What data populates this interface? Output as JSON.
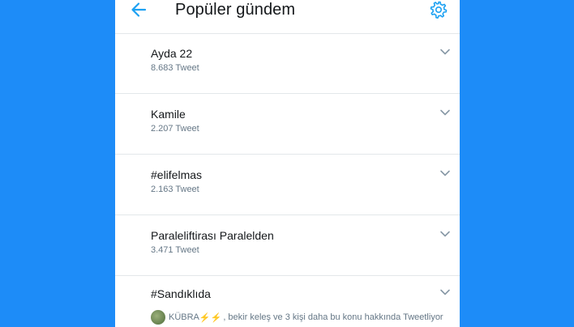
{
  "header": {
    "title": "Popüler gündem",
    "back_icon": "arrow-left-icon",
    "settings_icon": "gear-icon",
    "accent": "#1da1f2"
  },
  "trends": [
    {
      "title": "Ayda 22",
      "count": "8.683 Tweet"
    },
    {
      "title": "Kamile",
      "count": "2.207 Tweet"
    },
    {
      "title": "#elifelmas",
      "count": "2.163 Tweet"
    },
    {
      "title": "Paraleliftirası Paralelden",
      "count": "3.471 Tweet"
    },
    {
      "title": "#Sandıklıda",
      "tweeting": {
        "user": "KÜBRA",
        "emoji": "⚡⚡",
        "text": ", bekir keleş ve 3 kişi daha bu konu hakkında Tweetliyor"
      }
    }
  ],
  "colors": {
    "background": "#1d8cf8",
    "text_primary": "#14171a",
    "text_secondary": "#657786",
    "divider": "#e3e7ea"
  }
}
